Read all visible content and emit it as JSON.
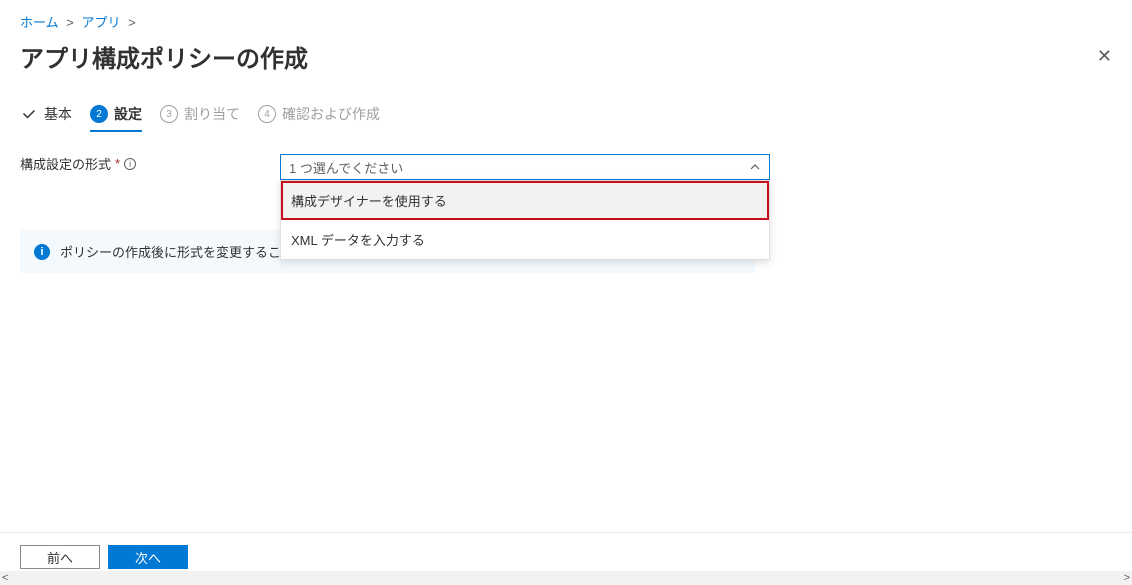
{
  "breadcrumb": {
    "home": "ホーム",
    "apps": "アプリ"
  },
  "title": "アプリ構成ポリシーの作成",
  "wizard": {
    "step1": "基本",
    "step2_num": "2",
    "step2": "設定",
    "step3_num": "3",
    "step3": "割り当て",
    "step4_num": "4",
    "step4": "確認および作成"
  },
  "form": {
    "format_label": "構成設定の形式",
    "dropdown_placeholder": "1 つ選んでください",
    "option1": "構成デザイナーを使用する",
    "option2": "XML データを入力する"
  },
  "banner": "ポリシーの作成後に形式を変更することはできません",
  "footer": {
    "back": "前へ",
    "next": "次へ"
  }
}
